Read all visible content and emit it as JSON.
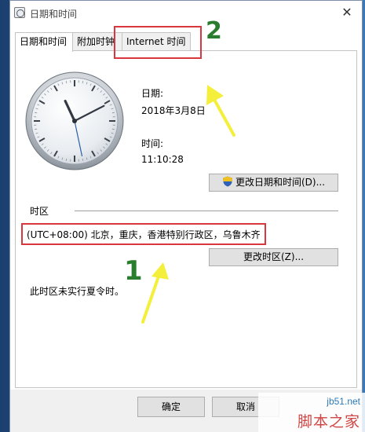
{
  "window": {
    "title": "日期和时间",
    "close_glyph": "✕"
  },
  "tabs": [
    {
      "label": "日期和时间",
      "active": true
    },
    {
      "label": "附加时钟",
      "active": false
    },
    {
      "label": "Internet 时间",
      "active": false
    }
  ],
  "datetime": {
    "date_label": "日期:",
    "date_value": "2018年3月8日",
    "time_label": "时间:",
    "time_value": "11:10:28",
    "change_button": "更改日期和时间(D)..."
  },
  "timezone": {
    "section_label": "时区",
    "value": "(UTC+08:00) 北京，重庆，香港特别行政区，乌鲁木齐",
    "change_button": "更改时区(Z)...",
    "dst_note": "此时区未实行夏令时。"
  },
  "dialog_buttons": {
    "ok": "确定",
    "cancel": "取消"
  },
  "annotations": {
    "step1": "1",
    "step2": "2",
    "highlight_color": "#d9363e",
    "number_color": "#2a7d2e",
    "arrow_color": "#f4ef3a"
  },
  "clock": {
    "hour": 11,
    "minute": 10,
    "second": 28
  },
  "watermark": {
    "site": "jb51.net",
    "name": "脚本之家"
  }
}
